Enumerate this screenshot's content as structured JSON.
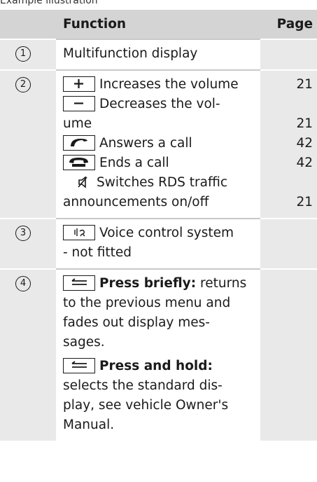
{
  "caption": "Example illustration",
  "headers": {
    "function": "Function",
    "page": "Page"
  },
  "rows": [
    {
      "num": "1",
      "function": "Multifunction display",
      "page": ""
    },
    {
      "num": "2",
      "items": [
        {
          "icon": "plus-icon",
          "text": "Increases the volume",
          "page": "21"
        },
        {
          "icon": "minus-icon",
          "text": "Decreases the vol-",
          "text2": "ume",
          "page": "21"
        },
        {
          "icon": "phone-answer-icon",
          "text": "Answers a call",
          "page": "42"
        },
        {
          "icon": "phone-end-icon",
          "text": "Ends a call",
          "page": "42"
        },
        {
          "icon": "speaker-mute-icon",
          "text": "Switches RDS traffic",
          "text2": "announcements on/off",
          "page": "21"
        }
      ]
    },
    {
      "num": "3",
      "icon": "voice-control-icon",
      "text": "Voice control system",
      "text2": "- not fitted",
      "page": ""
    },
    {
      "num": "4",
      "icon": "back-icon",
      "brief_label": "Press briefly:",
      "brief_text": "returns",
      "brief_lines": [
        "to the previous menu and",
        "fades out display mes-",
        "sages."
      ],
      "hold_label": "Press and hold:",
      "hold_lines": [
        "selects the standard dis-",
        "play, see vehicle Owner's",
        "Manual."
      ],
      "page": ""
    }
  ]
}
